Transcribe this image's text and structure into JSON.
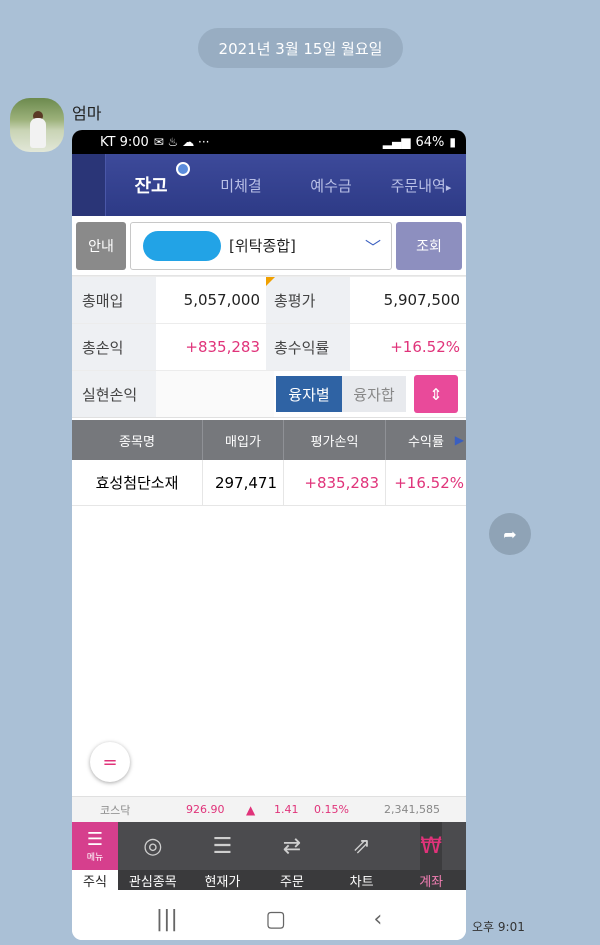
{
  "chat": {
    "date": "2021년 3월 15일 월요일",
    "sender": "엄마",
    "time": "오후 9:01"
  },
  "status_bar": {
    "carrier_time": "KT 9:00",
    "icons_left": "✉ ♨ ☁ ···",
    "battery": "64%"
  },
  "tabs": {
    "active": "잔고",
    "items": [
      "미체결",
      "예수금",
      "주문내역"
    ],
    "more_arrow": "▸"
  },
  "account": {
    "guide_label": "안내",
    "account_type": "[위탁종합]",
    "query_label": "조회"
  },
  "summary": {
    "total_buy_label": "총매입",
    "total_buy_value": "5,057,000",
    "total_eval_label": "총평가",
    "total_eval_value": "5,907,500",
    "total_pl_label": "총손익",
    "total_pl_value": "+835,283",
    "total_return_label": "총수익률",
    "total_return_value": "+16.52%",
    "realized_label": "실현손익"
  },
  "toggles": {
    "by_loan": "융자별",
    "loan_sum": "융자합"
  },
  "table": {
    "headers": [
      "종목명",
      "매입가",
      "평가손익",
      "수익률"
    ],
    "rows": [
      {
        "name": "효성첨단소재",
        "buy_price": "297,471",
        "pl": "+835,283",
        "return": "+16.52%"
      }
    ]
  },
  "ticker": {
    "name": "코스닥",
    "value": "926.90",
    "direction": "▲",
    "change": "1.41",
    "pct": "0.15%",
    "volume": "2,341,585"
  },
  "bottom_nav": {
    "menu_label": "메뉴",
    "menu_sub": "주식",
    "items": [
      "관심종목",
      "현재가",
      "주문",
      "차트",
      "계좌"
    ]
  },
  "colors": {
    "accent_pink": "#e0337a",
    "tab_blue": "#2d3a86",
    "chat_bg": "#aac0d6"
  }
}
